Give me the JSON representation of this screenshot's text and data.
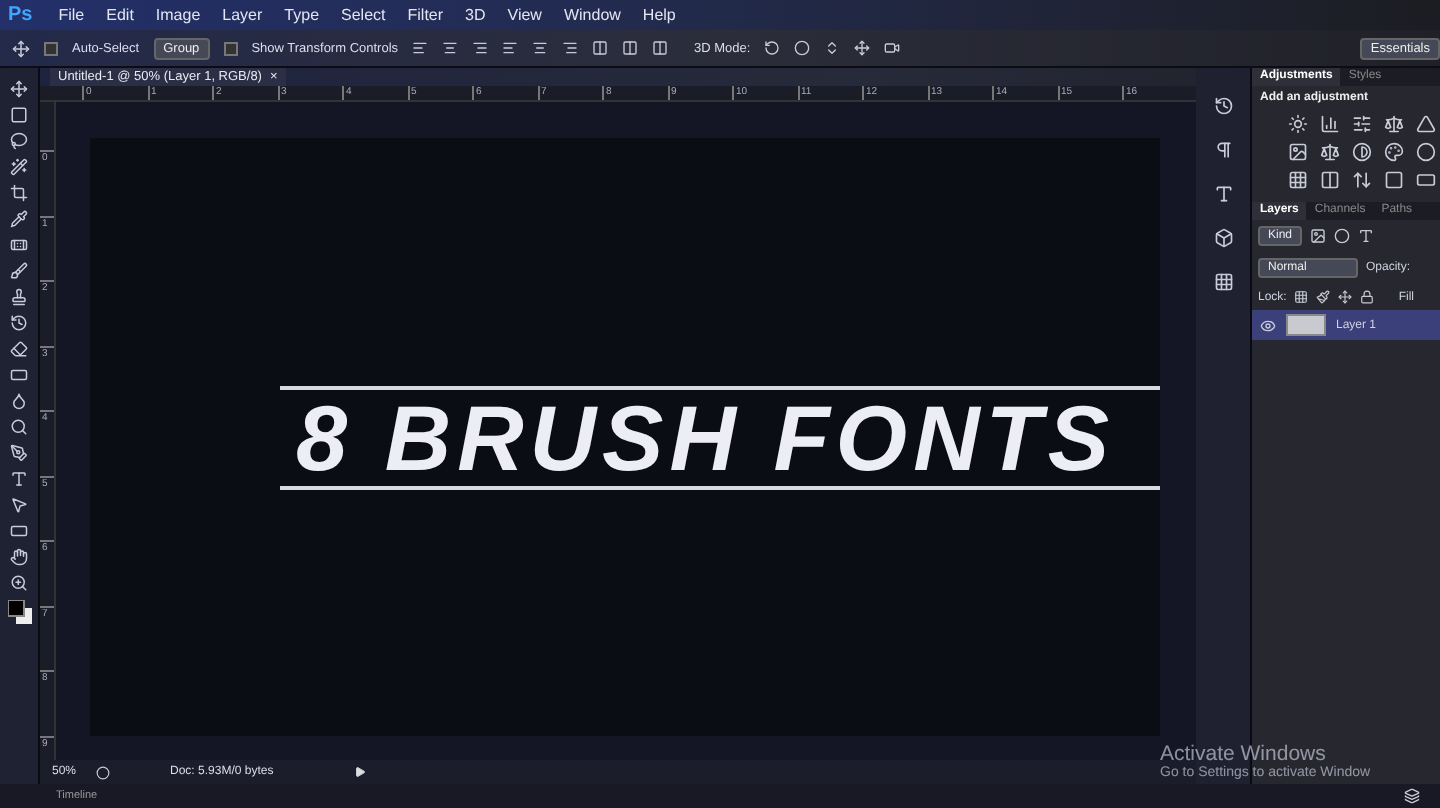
{
  "app_logo": "Ps",
  "menu": [
    "File",
    "Edit",
    "Image",
    "Layer",
    "Type",
    "Select",
    "Filter",
    "3D",
    "View",
    "Window",
    "Help"
  ],
  "options_bar": {
    "auto_select": {
      "label": "Auto-Select",
      "checked": false
    },
    "group_select": "Group",
    "transform_controls": {
      "label": "Show Transform Controls",
      "checked": false
    },
    "mode_label": "3D Mode:",
    "workspace": "Essentials"
  },
  "document_tab": {
    "title": "Untitled-1 @ 50% (Layer 1, RGB/8)",
    "close": "×"
  },
  "ruler_h": [
    "0",
    "1",
    "2",
    "3",
    "4",
    "5",
    "6",
    "7",
    "8",
    "9",
    "10",
    "11",
    "12",
    "13",
    "14",
    "15",
    "16"
  ],
  "ruler_v": [
    "0",
    "1",
    "2",
    "3",
    "4",
    "5",
    "6",
    "7",
    "8",
    "9"
  ],
  "canvas": {
    "headline": "8 BRUSH FONTS"
  },
  "status_bar": {
    "zoom": "50%",
    "doc_info": "Doc: 5.93M/0 bytes"
  },
  "timeline": "Timeline",
  "adjustments_panel": {
    "tabs": [
      {
        "label": "Adjustments",
        "selected": true
      },
      {
        "label": "Styles",
        "selected": false
      }
    ],
    "heading": "Add an adjustment"
  },
  "layers_panel": {
    "tabs": [
      {
        "label": "Layers",
        "selected": true
      },
      {
        "label": "Channels",
        "selected": false
      },
      {
        "label": "Paths",
        "selected": false
      }
    ],
    "filter": "Kind",
    "blend_mode": "Normal",
    "opacity_label": "Opacity:",
    "lock_label": "Lock:",
    "fill_label": "Fill",
    "layers": [
      {
        "name": "Layer 1",
        "visible": true,
        "selected": true
      }
    ]
  },
  "activation_notice": {
    "title": "Activate Windows",
    "message": "Go to Settings to activate Window"
  }
}
